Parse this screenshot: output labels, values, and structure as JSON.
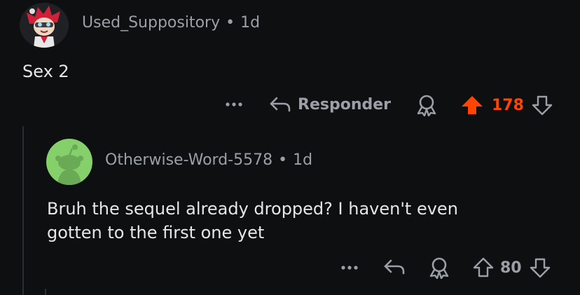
{
  "comments": [
    {
      "author": "Used_Suppository",
      "separator": "•",
      "age": "1d",
      "body": "Sex 2",
      "actions": {
        "more": "•••",
        "reply_label": "Responder",
        "score": "178",
        "upvoted": true
      }
    },
    {
      "author": "Otherwise-Word-5578",
      "separator": "•",
      "age": "1d",
      "body_line1": "Bruh the sequel already dropped? I haven't even",
      "body_line2": "gotten to the first one yet",
      "actions": {
        "more": "•••",
        "score": "80",
        "upvoted": false
      }
    }
  ],
  "colors": {
    "background": "#0e0f11",
    "upvote_active": "#ff4500",
    "muted_text": "#9aa0a6",
    "body_text": "#e4e6e8",
    "avatar2_bg": "#86d06b"
  },
  "icons": {
    "more": "more-icon",
    "reply": "reply-arrow-icon",
    "award": "award-icon",
    "upvote": "upvote-arrow-icon",
    "downvote": "downvote-arrow-icon"
  }
}
